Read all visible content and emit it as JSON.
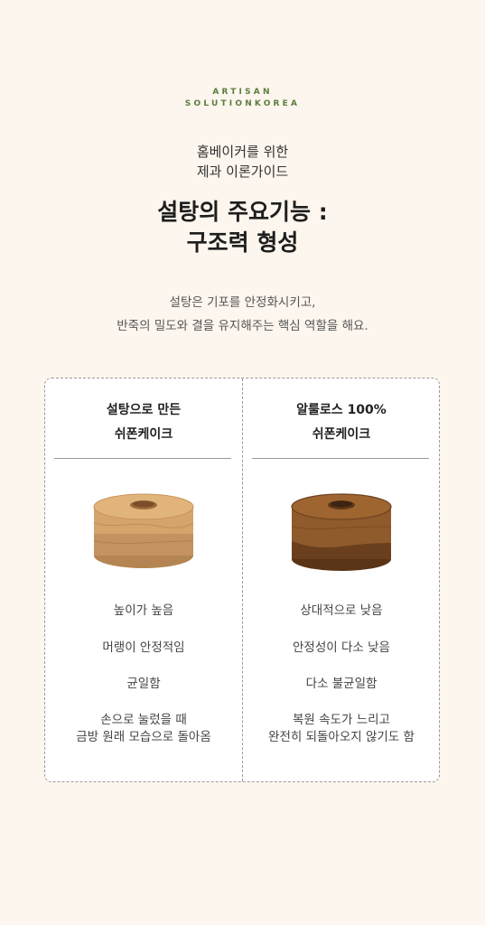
{
  "brand": {
    "line1": "ARTISAN",
    "line2": "SOLUTIONKOREA",
    "color": "#5b7d3e"
  },
  "header": {
    "subtitle_line1": "홈베이커를 위한",
    "subtitle_line2": "제과 이론가이드",
    "title_line1": "설탕의 주요기능 :",
    "title_line2": "구조력 형성"
  },
  "description": {
    "line1": "설탕은 기포를 안정화시키고,",
    "line2": "반죽의 밀도와 결을 유지해주는 핵심 역할을 해요."
  },
  "comparison": {
    "left": {
      "title_line1": "설탕으로 만든",
      "title_line2": "쉬폰케이크",
      "image": "sugar-chiffon-cake-photo",
      "features": [
        "높이가 높음",
        "머랭이 안정적임",
        "균일함",
        "손으로 눌렀을 때",
        "금방 원래 모습으로 돌아옴"
      ]
    },
    "right": {
      "title_line1": "알룰로스 100%",
      "title_line2": "쉬폰케이크",
      "image": "allulose-chiffon-cake-photo",
      "features": [
        "상대적으로 낮음",
        "안정성이 다소 낮음",
        "다소 불균일함",
        "복원 속도가 느리고",
        "완전히 되돌아오지 않기도 함"
      ]
    }
  }
}
